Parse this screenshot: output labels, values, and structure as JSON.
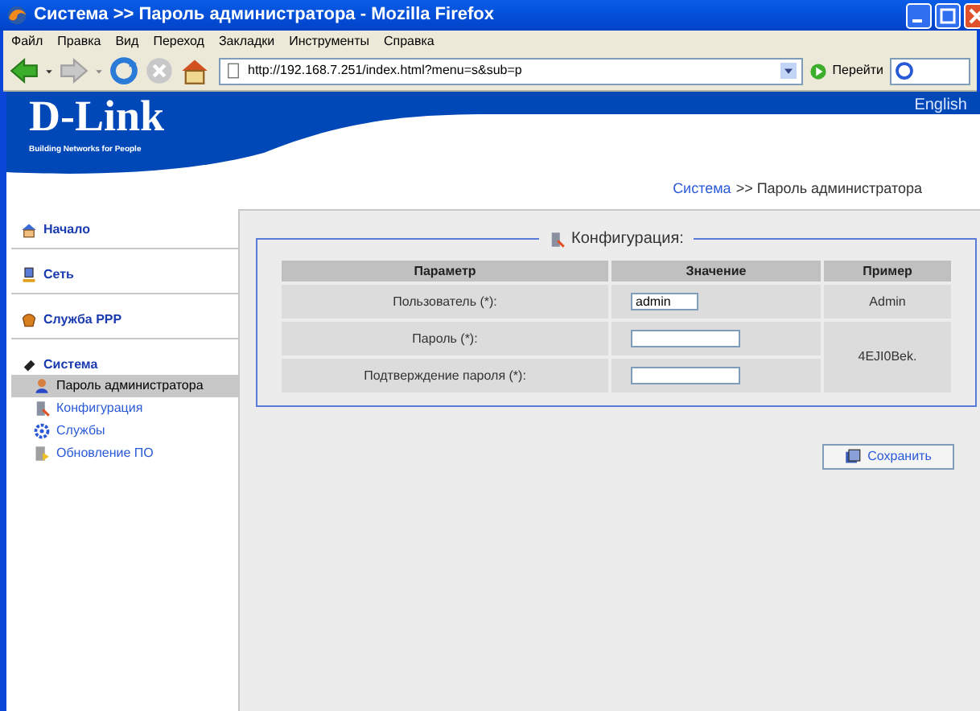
{
  "window": {
    "title": "Система >> Пароль администратора - Mozilla Firefox"
  },
  "menu": [
    "Файл",
    "Правка",
    "Вид",
    "Переход",
    "Закладки",
    "Инструменты",
    "Справка"
  ],
  "toolbar": {
    "url": "http://192.168.7.251/index.html?menu=s&sub=p",
    "go": "Перейти"
  },
  "header": {
    "language": "English",
    "logo": "D-Link",
    "tagline": "Building Networks for People"
  },
  "breadcrumb": [
    {
      "text": "Система",
      "kind": "link"
    },
    {
      "text": ">> Пароль администратора",
      "kind": "plain"
    }
  ],
  "sidebar": [
    {
      "label": "Начало"
    },
    {
      "label": "Сеть"
    },
    {
      "label": "Служба PPP"
    },
    {
      "label": "Система",
      "children": [
        {
          "label": "Пароль администратора",
          "selected": true
        },
        {
          "label": "Конфигурация",
          "selected": false
        },
        {
          "label": "Службы",
          "selected": false
        },
        {
          "label": "Обновление ПО",
          "selected": false
        }
      ]
    }
  ],
  "config": {
    "legend": "Конфигурация:",
    "columns": [
      "Параметр",
      "Значение",
      "Пример"
    ],
    "rows": [
      {
        "label": "Пользователь (*):",
        "value": "admin",
        "example": "Admin"
      },
      {
        "label": "Пароль (*):",
        "example": "4EJI0Bek."
      },
      {
        "label": "Подтверждение пароля (*):"
      }
    ]
  },
  "save_button": "Сохранить"
}
